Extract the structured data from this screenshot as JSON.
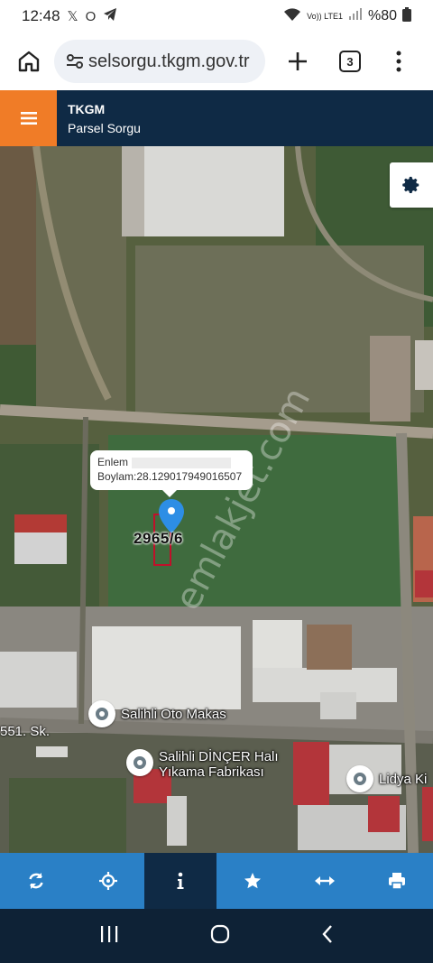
{
  "status_bar": {
    "time": "12:48",
    "app_icons": [
      "x-icon",
      "opera-icon",
      "telegram-icon"
    ],
    "network_label": "Vo)) LTE1",
    "battery": "%80"
  },
  "browser": {
    "url": "selsorgu.tkgm.gov.tr",
    "tab_count": "3"
  },
  "app": {
    "title": "TKGM",
    "subtitle": "Parsel Sorgu"
  },
  "popup": {
    "lat_label": "Enlem",
    "lon_text": "Boylam:28.129017949016507"
  },
  "parcel": {
    "number": "2965/6"
  },
  "watermark": "emlakjet.com",
  "pois": [
    {
      "label": "Salihli Oto Makas"
    },
    {
      "label": "Salihli DİNÇER Halı\nYıkama Fabrikası"
    },
    {
      "label": "Lidya Ki"
    }
  ],
  "road_label": "551. Sk.",
  "toolbar": {
    "items": [
      "refresh-icon",
      "locate-icon",
      "info-icon",
      "star-icon",
      "measure-icon",
      "print-icon"
    ],
    "active": "info-icon"
  },
  "colors": {
    "header_bg": "#0f2a45",
    "hamburger_bg": "#f07c27",
    "toolbar_bg": "#2a80c6",
    "pin": "#2d8ee5",
    "parcel_outline": "#c0102a"
  }
}
